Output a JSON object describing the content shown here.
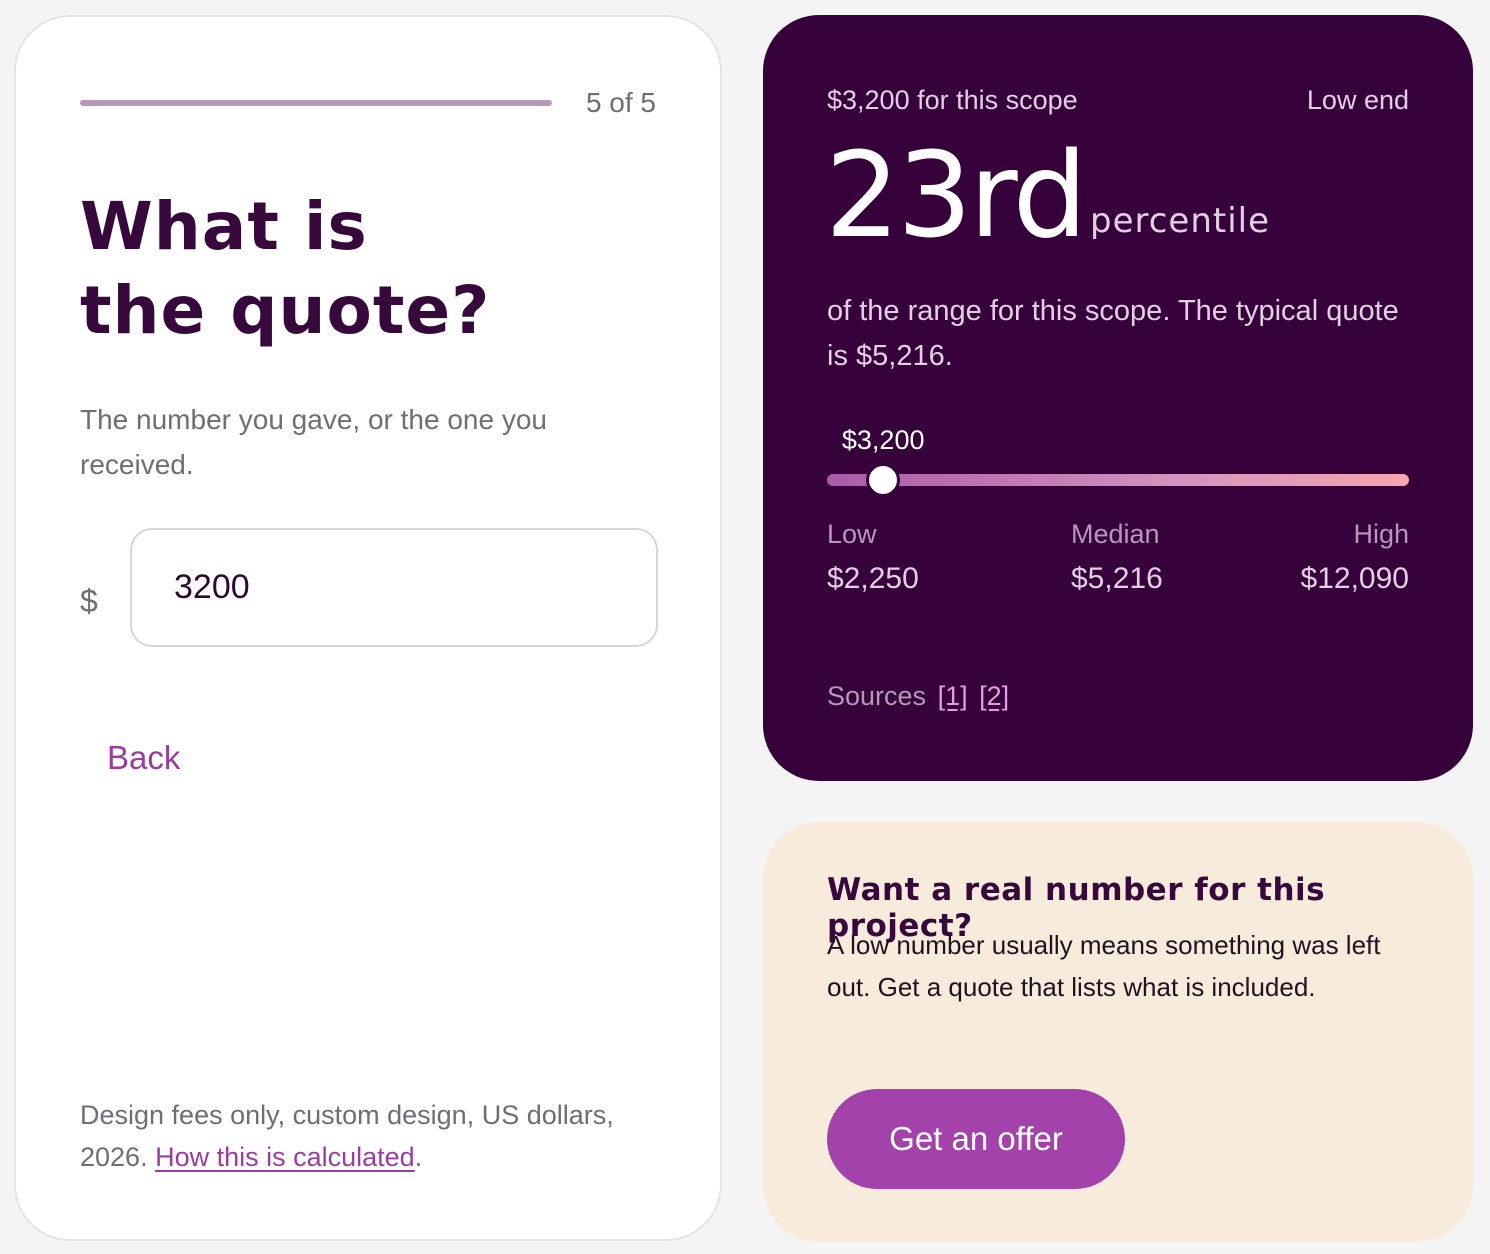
{
  "wizard": {
    "progress": 1.0,
    "step_label": "5 of 5",
    "title_line1": "What is",
    "title_line2": "the quote?",
    "help_text": "The number you gave, or the one you received.",
    "currency_symbol": "$",
    "amount_value": "3200",
    "back_label": "Back",
    "footnote_text": "Design fees only, custom design, US dollars, 2026. ",
    "footnote_link": "How this is calculated",
    "footnote_end": "."
  },
  "result": {
    "quote_caption": "$3,200 for this scope",
    "position_tag": "Low end",
    "percentile_value": "23rd",
    "percentile_unit": "percentile",
    "description": "of the range for this scope. The typical quote is $5,216.",
    "marker_label": "$3,200",
    "range": {
      "low": 2250,
      "median": 5216,
      "high": 12090,
      "quote": 3200
    },
    "stats": [
      {
        "label": "Low",
        "value": "$2,250"
      },
      {
        "label": "Median",
        "value": "$5,216"
      },
      {
        "label": "High",
        "value": "$12,090"
      }
    ],
    "sources_label": "Sources",
    "source_links": [
      "[1]",
      "[2]"
    ]
  },
  "cta": {
    "title": "Want a real number for this project?",
    "body": "A low number usually means something was left out. Get a quote that lists what is included.",
    "button_label": "Get an offer"
  }
}
